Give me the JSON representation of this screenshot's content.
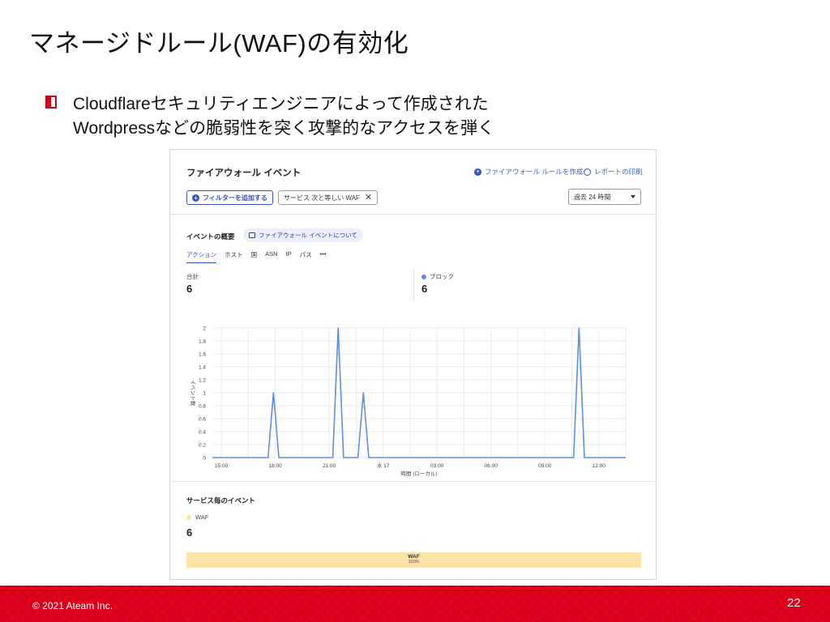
{
  "slide": {
    "title": "マネージドルール(WAF)の有効化",
    "bullet_line1": "Cloudflareセキュリティエンジニアによって作成された",
    "bullet_line2": "Wordpressなどの脆弱性を突く攻撃的なアクセスを弾く",
    "copyright": "© 2021 Ateam Inc.",
    "page_number": "22",
    "accent_color": "#e0001b"
  },
  "panel": {
    "title": "ファイアウォール イベント",
    "create_rule_link": "ファイアウォール ルールを作成",
    "print_report_link": "レポートの印刷",
    "add_filter_button": "フィルターを追加する",
    "filter_chip": "サービス 次と等しい WAF",
    "time_range": "過去 24 時間",
    "overview_title": "イベントの概要",
    "about_link": "ファイアウォール イベントについて",
    "tabs": [
      "アクション",
      "ホスト",
      "国",
      "ASN",
      "IP",
      "パス",
      "•••"
    ],
    "active_tab": "アクション",
    "stats": {
      "total_label": "合計",
      "total_value": "6",
      "block_label": "ブロック",
      "block_value": "6",
      "block_color": "#5b8ee6"
    },
    "services": {
      "title": "サービス毎のイベント",
      "legend_label": "WAF",
      "legend_color": "#fbe3a6",
      "value": "6",
      "bar_label": "WAF",
      "bar_percent": "100%"
    }
  },
  "chart_data": {
    "type": "line",
    "ylabel": "イベント数",
    "xlabel": "時間 (ローカル)",
    "x_tick_labels": [
      "15:00",
      "18:00",
      "21:00",
      "水 17",
      "03:00",
      "06:00",
      "09:00",
      "12:00"
    ],
    "y_ticks": [
      0,
      0.2,
      0.4,
      0.6,
      0.8,
      1,
      1.2,
      1.4,
      1.6,
      1.8,
      2
    ],
    "ylim": [
      0,
      2
    ],
    "xlim": [
      14.5,
      37.5
    ],
    "grid": true,
    "series": [
      {
        "color": "#5b8ee6",
        "x": [
          14.5,
          17.6,
          17.9,
          18.2,
          21.2,
          21.5,
          21.8,
          22.6,
          22.9,
          23.2,
          34.6,
          34.9,
          35.2,
          37.5
        ],
        "y": [
          0,
          0,
          1,
          0,
          0,
          2,
          0,
          0,
          1,
          0,
          0,
          2,
          0,
          0
        ]
      }
    ]
  }
}
